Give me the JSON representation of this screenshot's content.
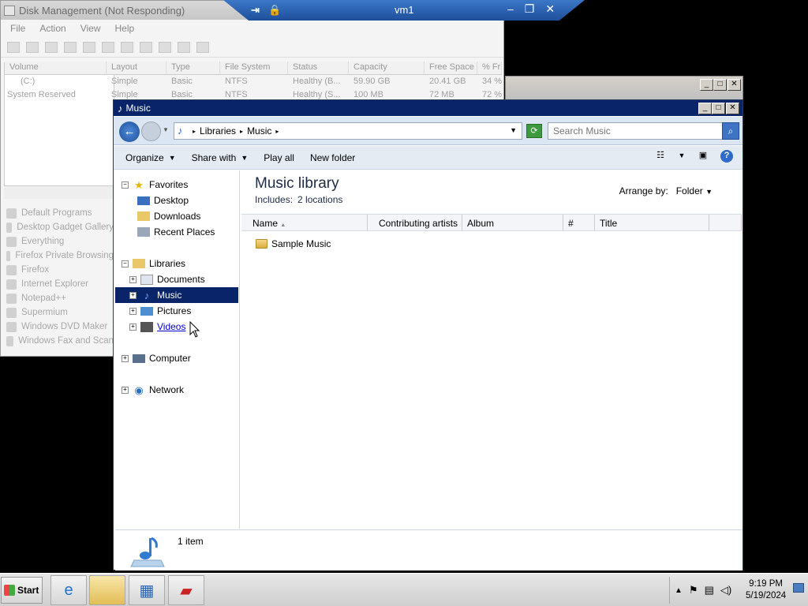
{
  "vm_bar": {
    "pin_icon": "pin-icon",
    "lock_icon": "lock-icon",
    "name": "vm1",
    "min": "–",
    "restore": "❐",
    "close": "✕"
  },
  "disk_mgmt": {
    "title": "Disk Management (Not Responding)",
    "menu": [
      "File",
      "Action",
      "View",
      "Help"
    ],
    "columns": [
      "Volume",
      "Layout",
      "Type",
      "File System",
      "Status",
      "Capacity",
      "Free Space",
      "% Fr"
    ],
    "rows": [
      [
        "(C:)",
        "Simple",
        "Basic",
        "NTFS",
        "Healthy (B...",
        "59.90 GB",
        "20.41 GB",
        "34 %"
      ],
      [
        "System Reserved",
        "Simple",
        "Basic",
        "NTFS",
        "Healthy (S...",
        "100 MB",
        "72 MB",
        "72 %"
      ]
    ],
    "programs": [
      "Default Programs",
      "Desktop Gadget Gallery",
      "Everything",
      "Firefox Private Browsing",
      "Firefox",
      "Internet Explorer",
      "Notepad++",
      "Supermium",
      "Windows DVD Maker",
      "Windows Fax and Scan"
    ]
  },
  "explorer": {
    "title": "Music",
    "breadcrumb": [
      "Libraries",
      "Music"
    ],
    "search_placeholder": "Search Music",
    "commands": {
      "organize": "Organize",
      "share": "Share with",
      "play": "Play all",
      "new_folder": "New folder"
    },
    "nav": {
      "favorites": "Favorites",
      "fav_items": [
        "Desktop",
        "Downloads",
        "Recent Places"
      ],
      "libraries": "Libraries",
      "lib_items": [
        "Documents",
        "Music",
        "Pictures",
        "Videos"
      ],
      "computer": "Computer",
      "network": "Network"
    },
    "library_title": "Music library",
    "includes_label": "Includes:",
    "includes_value": "2 locations",
    "arrange_label": "Arrange by:",
    "arrange_value": "Folder",
    "columns": [
      "Name",
      "Contributing artists",
      "Album",
      "#",
      "Title"
    ],
    "items": [
      "Sample Music"
    ],
    "item_count": "1 item"
  },
  "taskbar": {
    "start": "Start",
    "apps": [
      "internet-explorer-icon",
      "explorer-icon",
      "server-manager-icon",
      "toolbox-icon"
    ],
    "time": "9:19 PM",
    "date": "5/19/2024"
  }
}
